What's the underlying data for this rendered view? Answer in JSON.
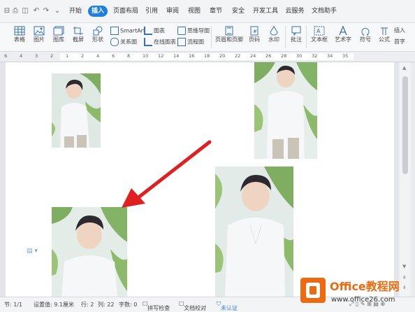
{
  "quick_access": [
    "save-icon",
    "print-icon",
    "preview-icon",
    "undo-icon",
    "redo-icon",
    "customize-icon"
  ],
  "menu": [
    {
      "label": "开始"
    },
    {
      "label": "插入",
      "active": true
    },
    {
      "label": "页面布局"
    },
    {
      "label": "引用"
    },
    {
      "label": "审阅"
    },
    {
      "label": "视图"
    },
    {
      "label": "章节"
    },
    {
      "label": "安全"
    },
    {
      "label": "开发工具"
    },
    {
      "label": "云服务"
    },
    {
      "label": "文档助手"
    }
  ],
  "ribbon": {
    "big": [
      {
        "label": "表格",
        "icon": "table-icon"
      },
      {
        "label": "图片",
        "icon": "picture-icon"
      },
      {
        "label": "图库",
        "icon": "gallery-icon"
      },
      {
        "label": "截屏",
        "icon": "screenshot-icon"
      },
      {
        "label": "形状",
        "icon": "shapes-icon"
      }
    ],
    "small_left": [
      {
        "label": "SmartArt",
        "icon": "smartart-icon"
      },
      {
        "label": "关系图",
        "icon": "relation-icon"
      }
    ],
    "small_mid": [
      {
        "label": "图表",
        "icon": "chart-icon"
      },
      {
        "label": "在线图表",
        "icon": "online-chart-icon"
      }
    ],
    "small_right": [
      {
        "label": "思维导图",
        "icon": "mindmap-icon"
      },
      {
        "label": "流程图",
        "icon": "flowchart-icon"
      }
    ],
    "big2": [
      {
        "label": "页眉和页脚",
        "icon": "header-footer-icon"
      },
      {
        "label": "页码",
        "icon": "page-number-icon"
      },
      {
        "label": "水印",
        "icon": "watermark-icon"
      },
      {
        "label": "批注",
        "icon": "comment-icon"
      },
      {
        "label": "文本框",
        "icon": "textbox-icon"
      },
      {
        "label": "艺术字",
        "icon": "wordart-icon"
      },
      {
        "label": "符号",
        "icon": "symbol-icon"
      },
      {
        "label": "公式",
        "icon": "formula-icon"
      }
    ],
    "tail": [
      {
        "label": "插入"
      },
      {
        "label": "首字"
      }
    ]
  },
  "ruler_numbers": [
    "6",
    "4",
    "3",
    "2",
    "1",
    "2",
    "4",
    "6",
    "8",
    "10",
    "12",
    "14",
    "16",
    "18",
    "20",
    "22",
    "24",
    "26",
    "28",
    "30",
    "32",
    "34",
    "35"
  ],
  "statusbar": {
    "section": "节: 1/1",
    "setting": "设置值: 9.1厘米",
    "row": "行: 2",
    "col": "列: 22",
    "words": "字数: 0",
    "spell": "拼写检查",
    "proof": "文档校对",
    "auth": "未认证"
  },
  "watermark": {
    "brand": "Office教程网",
    "url": "www.office26.com"
  },
  "colors": {
    "accent": "#1f7ee0",
    "arrow": "#e02020",
    "watermark_orange": "#ee6a10"
  }
}
